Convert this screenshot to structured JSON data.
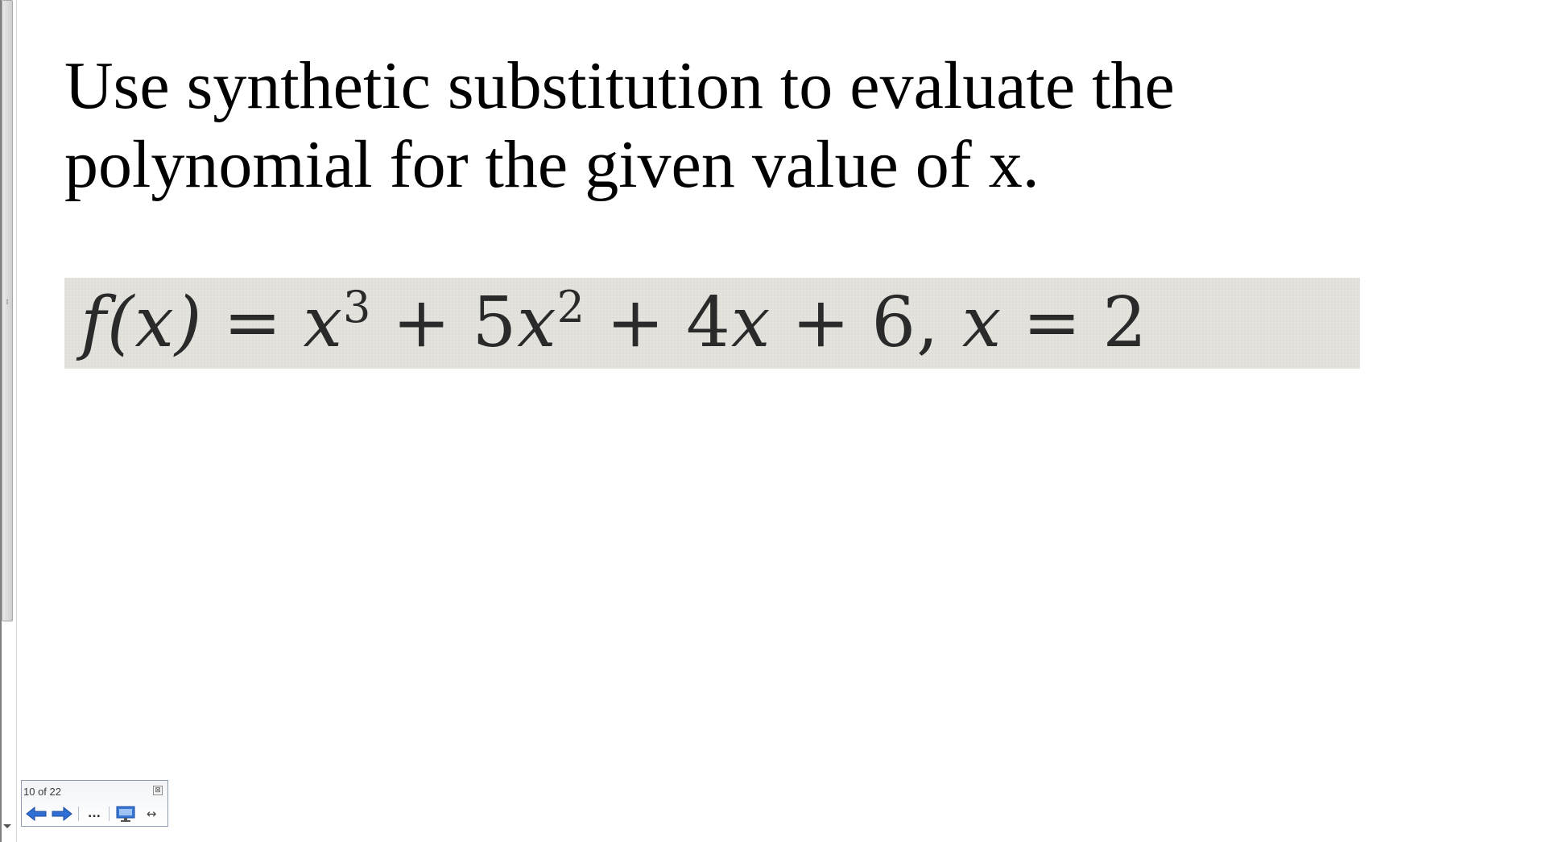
{
  "slide": {
    "title": "Use synthetic substitution to evaluate the polynomial for the given value of x.",
    "equation": {
      "fx": "f(x)",
      "eq1": "=",
      "term1_base": "x",
      "term1_exp": "3",
      "plus1": "+",
      "term2_coef": "5",
      "term2_base": "x",
      "term2_exp": "2",
      "plus2": "+",
      "term3_coef": "4",
      "term3_base": "x",
      "plus3": "+",
      "constant": "6,",
      "var": "x",
      "eq2": "=",
      "value": "2"
    }
  },
  "navigator": {
    "position_label": "10 of 22",
    "close_glyph": "⊠",
    "more_glyph": "...",
    "fit_glyph": "↔",
    "icons": [
      "arrow-left-icon",
      "arrow-right-icon",
      "more-icon",
      "screen-icon",
      "resize-icon"
    ],
    "arrow_color": "#2f6fd6"
  }
}
